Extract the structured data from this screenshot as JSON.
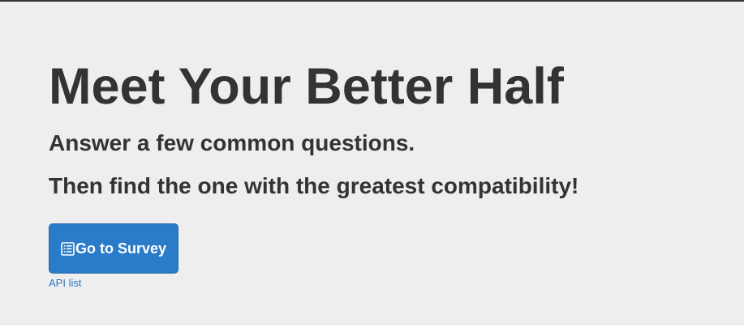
{
  "hero": {
    "title": "Meet Your Better Half",
    "line_1": "Answer a few common questions.",
    "line_2": "Then find the one with the greatest compatibility!"
  },
  "actions": {
    "survey_button_label": "Go to Survey",
    "survey_button_icon": "list-alt-icon",
    "api_link_label": "API list"
  },
  "colors": {
    "background": "#eeeeee",
    "primary": "#2a7bc8",
    "text": "#333333"
  }
}
